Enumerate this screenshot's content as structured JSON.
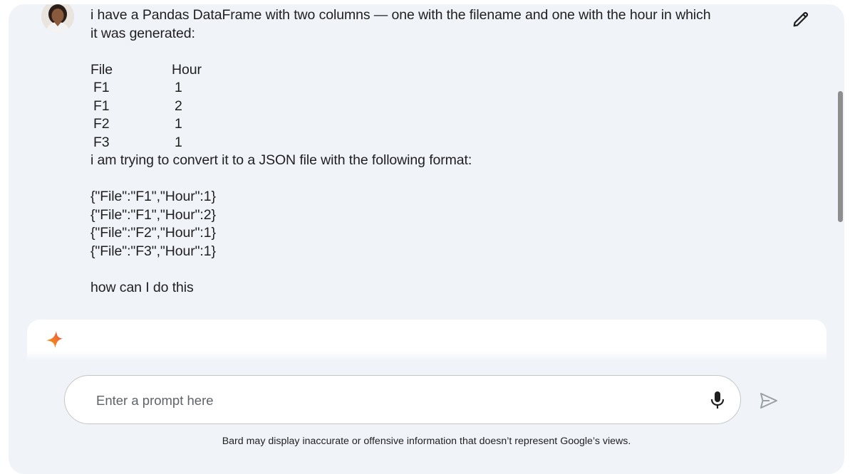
{
  "user_message": {
    "intro": "i have a Pandas DataFrame with two columns — one with the filename and one with the hour in which it was generated:",
    "table": {
      "headers": [
        "File",
        "Hour"
      ],
      "rows": [
        [
          "F1",
          "1"
        ],
        [
          "F1",
          "2"
        ],
        [
          "F2",
          "1"
        ],
        [
          "F3",
          "1"
        ]
      ]
    },
    "format_intro": "i am trying to convert it to a JSON file with the following format:",
    "json_lines": [
      "{\"File\":\"F1\",\"Hour\":1}",
      "{\"File\":\"F1\",\"Hour\":2}",
      "{\"File\":\"F2\",\"Hour\":1}",
      "{\"File\":\"F3\",\"Hour\":1}"
    ],
    "question": "how can I do this"
  },
  "icons": {
    "avatar": "user-avatar",
    "edit": "pencil-icon",
    "response": "bard-sparkle-icon",
    "mic": "microphone-icon",
    "send": "send-icon"
  },
  "prompt": {
    "placeholder": "Enter a prompt here",
    "value": ""
  },
  "disclaimer": "Bard may display inaccurate or offensive information that doesn’t represent Google’s views.",
  "colors": {
    "background": "#f0f4f9",
    "card": "#ffffff",
    "text": "#1f1f1f",
    "placeholder": "#5f6368",
    "scrollbar": "#8e8e8e"
  }
}
